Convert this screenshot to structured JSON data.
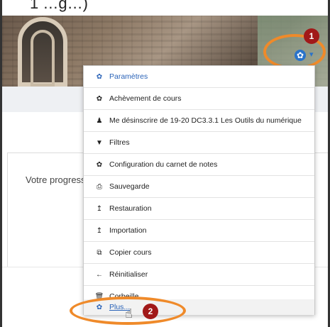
{
  "caption": {
    "text": "1 …g…)"
  },
  "page": {
    "progress_label": "Votre progress"
  },
  "header": {
    "settings_icon": "gear-icon",
    "caret_icon": "chevron-down-icon"
  },
  "badges": {
    "first": "1",
    "second": "2"
  },
  "menu": {
    "items": [
      {
        "label": "Paramètres",
        "icon": "gear-icon",
        "glyph": "✿"
      },
      {
        "label": "Achèvement de cours",
        "icon": "gear-icon",
        "glyph": "✿"
      },
      {
        "label": "Me désinscrire de 19-20 DC3.3.1 Les Outils du numérique",
        "icon": "user-icon",
        "glyph": "♟"
      },
      {
        "label": "Filtres",
        "icon": "filter-icon",
        "glyph": "▼"
      },
      {
        "label": "Configuration du carnet de notes",
        "icon": "gear-icon",
        "glyph": "✿"
      },
      {
        "label": "Sauvegarde",
        "icon": "save-icon",
        "glyph": "⎙"
      },
      {
        "label": "Restauration",
        "icon": "restore-icon",
        "glyph": "↥"
      },
      {
        "label": "Importation",
        "icon": "import-icon",
        "glyph": "↥"
      },
      {
        "label": "Copier cours",
        "icon": "copy-icon",
        "glyph": "⧉"
      },
      {
        "label": "Réinitialiser",
        "icon": "arrow-left-icon",
        "glyph": "←"
      },
      {
        "label": "Corbeille",
        "icon": "trash-icon",
        "glyph": "🗑"
      },
      {
        "label": "Plus...",
        "icon": "gear-icon",
        "glyph": "✿"
      }
    ]
  },
  "colors": {
    "link_blue": "#2a63b8",
    "highlight_orange": "#ef8a2a",
    "badge_red": "#a11919"
  }
}
